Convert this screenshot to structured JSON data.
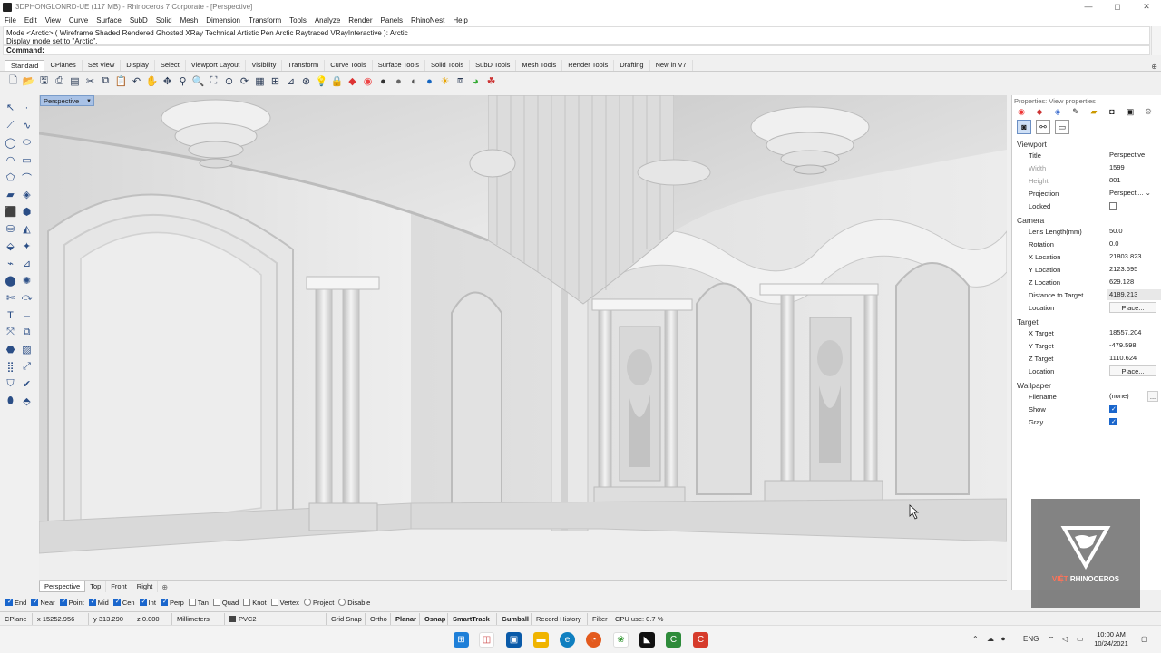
{
  "window": {
    "title": "3DPHONGLONRD-UE (117 MB) - Rhinoceros 7 Corporate - [Perspective]",
    "min": "—",
    "max": "◻",
    "close": "✕"
  },
  "menu": [
    "File",
    "Edit",
    "View",
    "Curve",
    "Surface",
    "SubD",
    "Solid",
    "Mesh",
    "Dimension",
    "Transform",
    "Tools",
    "Analyze",
    "Render",
    "Panels",
    "RhinoNest",
    "Help"
  ],
  "command_history": [
    "Mode <Arctic> ( Wireframe  Shaded  Rendered  Ghosted  XRay  Technical  Artistic  Pen  Arctic  Raytraced  VRayInteractive ): Arctic",
    "Display mode set to \"Arctic\"."
  ],
  "command_prompt": "Command:",
  "toolbar_tabs": [
    "Standard",
    "CPlanes",
    "Set View",
    "Display",
    "Select",
    "Viewport Layout",
    "Visibility",
    "Transform",
    "Curve Tools",
    "Surface Tools",
    "Solid Tools",
    "SubD Tools",
    "Mesh Tools",
    "Render Tools",
    "Drafting",
    "New in V7"
  ],
  "active_tab": "Standard",
  "toolbar_icons": [
    "new-icon",
    "open-icon",
    "save-icon",
    "print-icon",
    "import-icon",
    "cut-icon",
    "copy-icon",
    "paste-icon",
    "undo-icon",
    "pan-icon",
    "move-view-icon",
    "zoom-icon",
    "zoom-window-icon",
    "zoom-extents-icon",
    "zoom-selected-icon",
    "rotate-view-icon",
    "viewport-layout-icon",
    "grid-icon",
    "cplane-icon",
    "snap-icon",
    "light-icon",
    "lock-icon",
    "paint-icon",
    "color-wheel-icon",
    "sphere-shaded-icon",
    "sphere-render-icon",
    "material-icon",
    "env-icon",
    "sun-icon",
    "groups-icon",
    "object-props-icon",
    "render-icon"
  ],
  "viewport": {
    "title": "Perspective",
    "cursor_hint": "",
    "tabs": [
      "Perspective",
      "Top",
      "Front",
      "Right"
    ],
    "add_tab": "⊕"
  },
  "osnaps": [
    {
      "label": "End",
      "on": true
    },
    {
      "label": "Near",
      "on": true
    },
    {
      "label": "Point",
      "on": true
    },
    {
      "label": "Mid",
      "on": true
    },
    {
      "label": "Cen",
      "on": true
    },
    {
      "label": "Int",
      "on": true
    },
    {
      "label": "Perp",
      "on": true
    },
    {
      "label": "Tan",
      "on": false
    },
    {
      "label": "Quad",
      "on": false
    },
    {
      "label": "Knot",
      "on": false
    },
    {
      "label": "Vertex",
      "on": false
    },
    {
      "label": "Project",
      "on": false
    },
    {
      "label": "Disable",
      "on": false
    }
  ],
  "status": {
    "cplane": "CPlane",
    "x": "x 15252.956",
    "y": "y 313.290",
    "z": "z 0.000",
    "units": "Millimeters",
    "layer": "PVC2",
    "grid_snap": "Grid Snap",
    "ortho": "Ortho",
    "planar": "Planar",
    "osnap": "Osnap",
    "smarttrack": "SmartTrack",
    "gumball": "Gumball",
    "record_history": "Record History",
    "filter": "Filter",
    "cpu": "CPU use: 0.7 %"
  },
  "panel": {
    "title": "Properties: View properties",
    "viewport_section": "Viewport",
    "viewport_rows": [
      {
        "k": "Title",
        "v": "Perspective"
      },
      {
        "k": "Width",
        "v": "1599",
        "dim": true
      },
      {
        "k": "Height",
        "v": "801",
        "dim": true
      },
      {
        "k": "Projection",
        "v": "Perspecti...  ⌄"
      },
      {
        "k": "Locked",
        "v": ""
      }
    ],
    "camera_section": "Camera",
    "camera_rows": [
      {
        "k": "Lens Length(mm)",
        "v": "50.0"
      },
      {
        "k": "Rotation",
        "v": "0.0"
      },
      {
        "k": "X Location",
        "v": "21803.823"
      },
      {
        "k": "Y Location",
        "v": "2123.695"
      },
      {
        "k": "Z Location",
        "v": "629.128"
      },
      {
        "k": "Distance to Target",
        "v": "4189.213"
      }
    ],
    "camera_location_label": "Location",
    "place_button": "Place...",
    "target_section": "Target",
    "target_rows": [
      {
        "k": "X Target",
        "v": "18557.204"
      },
      {
        "k": "Y Target",
        "v": "-479.598"
      },
      {
        "k": "Z Target",
        "v": "1110.624"
      }
    ],
    "target_location_label": "Location",
    "wallpaper_section": "Wallpaper",
    "filename_label": "Filename",
    "filename_value": "(none)",
    "browse": "...",
    "show_label": "Show",
    "gray_label": "Gray"
  },
  "logo": {
    "viet": "VIỆT",
    "brand": " RHINOCEROS"
  },
  "taskbar": {
    "time": "10:00 AM",
    "date": "10/24/2021",
    "lang": "ENG"
  }
}
